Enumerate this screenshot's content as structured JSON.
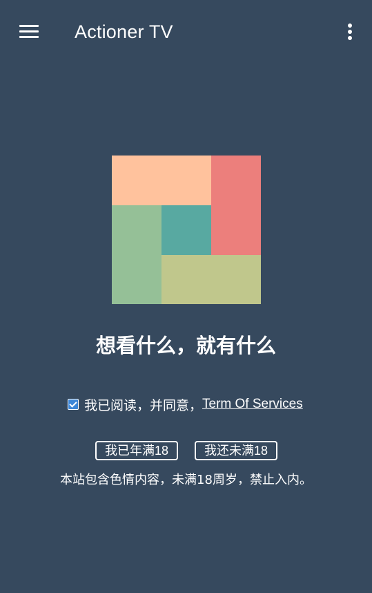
{
  "app": {
    "title": "Actioner TV"
  },
  "icons": {
    "menu": "hamburger-menu-icon",
    "more": "vertical-ellipsis-icon"
  },
  "logo": {
    "colors": {
      "peach": "#ffc29d",
      "red": "#ec7f7c",
      "green": "#95c097",
      "teal": "#58a9a1",
      "olive": "#c0c78c"
    }
  },
  "main": {
    "tagline": "想看什么，就有什么",
    "agree": {
      "checked": true,
      "text": "我已阅读，并同意，",
      "link": "Term Of Services"
    },
    "buttons": {
      "adult": "我已年满18",
      "minor": "我还未满18"
    },
    "notice": "本站包含色情内容，未满18周岁，禁止入内。"
  },
  "colors": {
    "background": "#36495e",
    "checkbox": "#3d86d6",
    "text": "#ffffff"
  }
}
